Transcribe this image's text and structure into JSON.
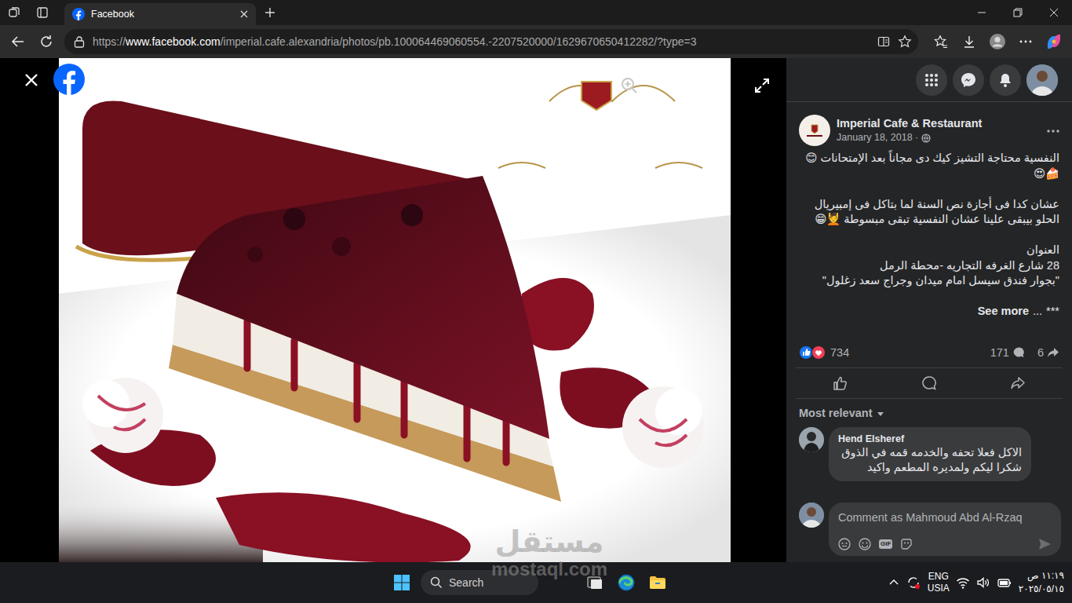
{
  "browser": {
    "tabs": [
      {
        "label": "Facebook",
        "selected": true
      }
    ],
    "address": {
      "scheme": "https://",
      "host": "www.facebook.com",
      "path": "/imperial.cafe.alexandria/photos/pb.100064469060554.-2207520000/1629670650412282/?type=3"
    }
  },
  "post": {
    "author": "Imperial Cafe & Restaurant",
    "date": "January 18, 2018 ·",
    "body": [
      [
        "النفسية محتاجة التشيز كيك دى مجاناً بعد الإمتحانات 😊🍰😍"
      ],
      [
        "عشان كدا فى أجازة نص السنة لما بتاكل فى إمبيريال الحلو بيبقى علينا عشان النفسية تبقى مبسوطة 💆😁"
      ],
      [
        "العنوان",
        "28 شارع الغرفه التجاريه -محطة الرمل",
        "\"بجوار فندق سيسل امام ميدان وجراج سعد زغلول\""
      ]
    ],
    "more": {
      "label": "See more",
      "ellipsis": "...",
      "tail": "***"
    },
    "reactions": "734",
    "comments": "171",
    "shares": "6"
  },
  "comments": {
    "sort": "Most relevant",
    "items": [
      {
        "author": "Hend Elsheref",
        "text": "الاكل فعلا تحفه والخدمه قمه في الذوق شكرا ليكم ولمديره المطعم واكيد"
      }
    ]
  },
  "composer": {
    "placeholder": "Comment as Mahmoud Abd Al-Rzaq",
    "gif": "GIF"
  },
  "taskbar": {
    "search": "Search",
    "language": "ENG",
    "region": "USIA",
    "time": "١١:١٩ ص",
    "date": "٢٠٢٥/٠٥/١٥"
  },
  "watermark": {
    "logo": "مستقل",
    "url": "mostaql.com"
  }
}
